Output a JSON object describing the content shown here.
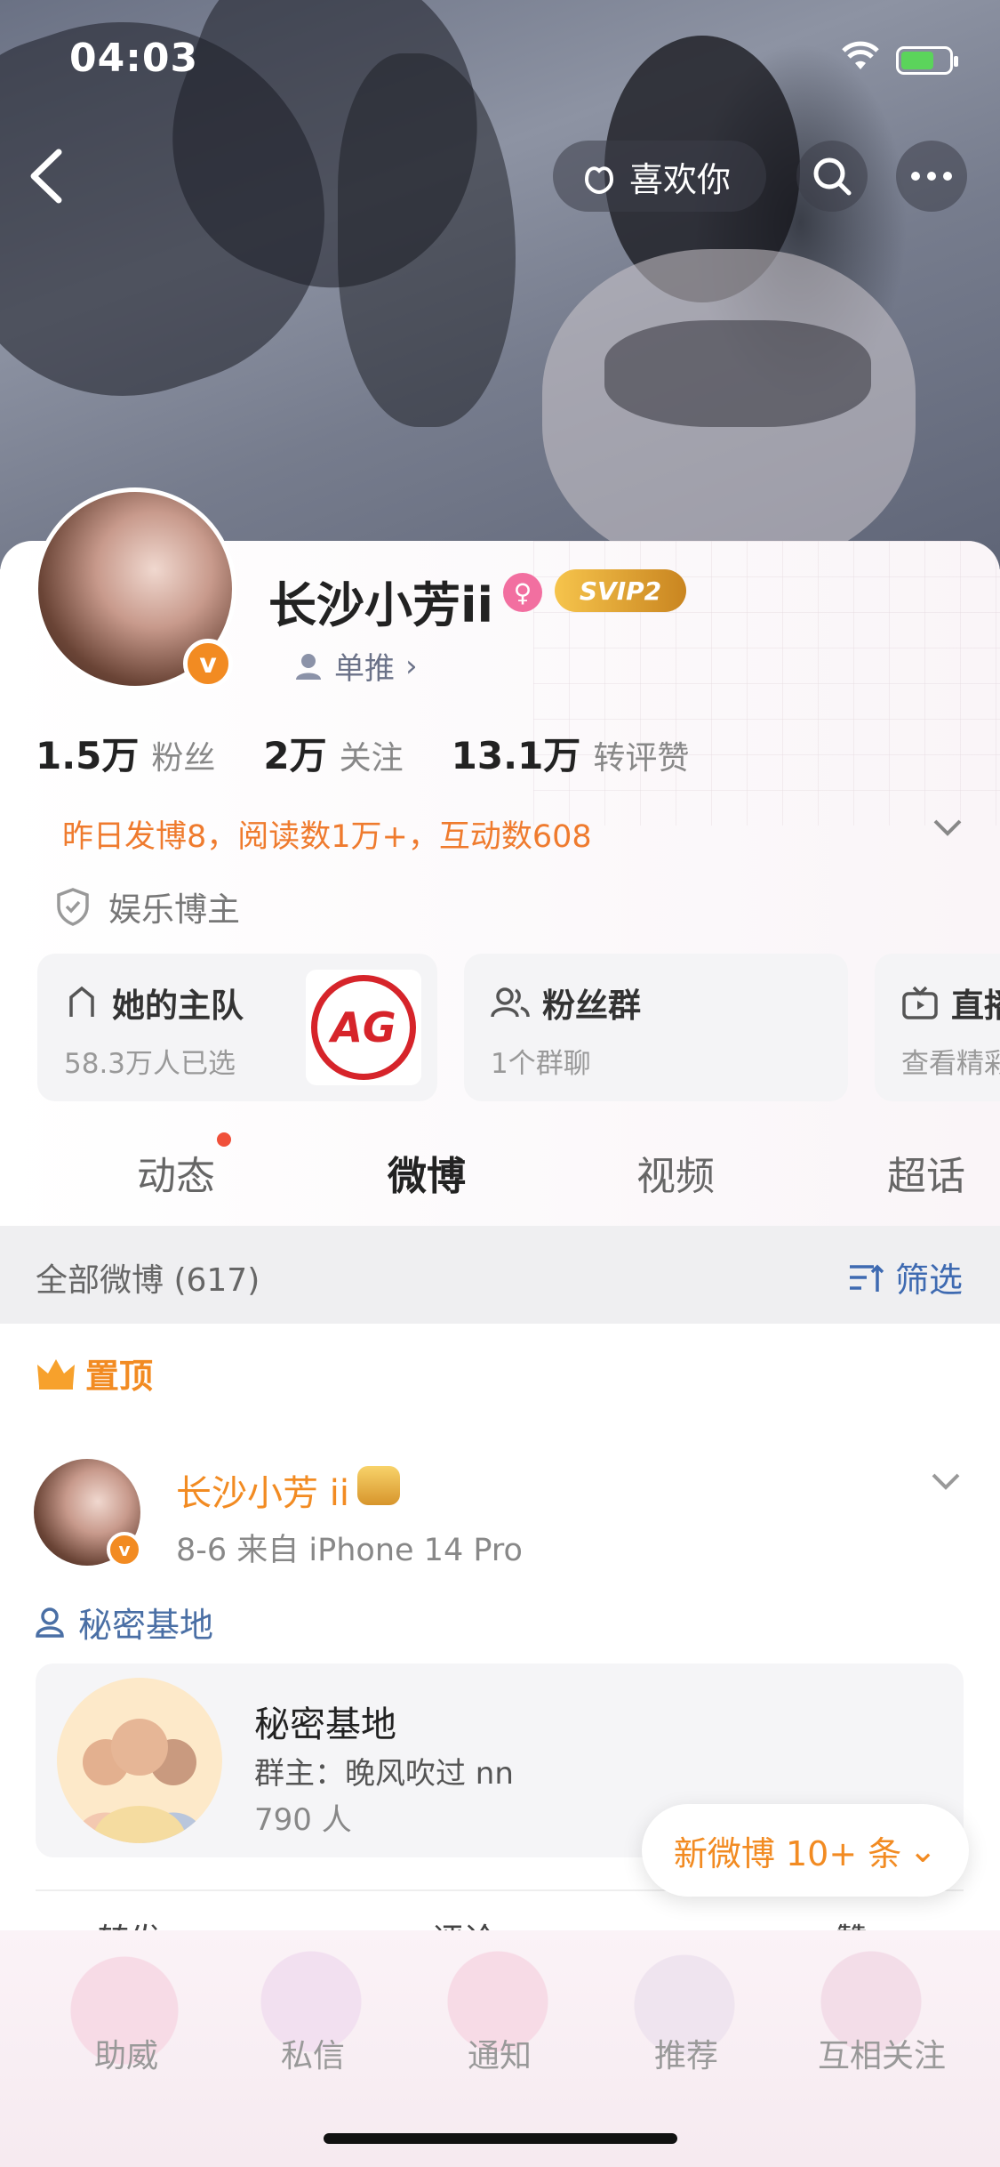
{
  "status_bar": {
    "time": "04:03"
  },
  "header": {
    "like_label": "喜欢你"
  },
  "profile": {
    "name": "长沙小芳ii",
    "vip": "SVIP2",
    "single_label": "单推",
    "stats": [
      {
        "num": "1.5万",
        "label": "粉丝"
      },
      {
        "num": "2万",
        "label": "关注"
      },
      {
        "num": "13.1万",
        "label": "转评赞"
      }
    ],
    "yesterday": "昨日发博8，阅读数1万+，互动数608",
    "category": "娱乐博主"
  },
  "boxes": [
    {
      "title": "她的主队",
      "sub": "58.3万人已选",
      "logo": "AG"
    },
    {
      "title": "粉丝群",
      "sub": "1个群聊"
    },
    {
      "title": "直播",
      "sub": "查看精彩回"
    }
  ],
  "tabs": [
    "动态",
    "微博",
    "视频",
    "超话"
  ],
  "filter": {
    "all": "全部微博 (617)",
    "filter_label": "筛选"
  },
  "pinned_label": "置顶",
  "post": {
    "author": "长沙小芳 ii",
    "meta": "8-6  来自 iPhone 14 Pro",
    "tag": "秘密基地",
    "group": {
      "title": "秘密基地",
      "owner": "群主：晚风吹过 nn",
      "count": "790 人"
    },
    "actions": [
      "转发",
      "评论",
      "赞"
    ]
  },
  "new_posts_pill": "新微博 10+ 条",
  "tabbar": [
    "助威",
    "私信",
    "通知",
    "推荐",
    "互相关注"
  ]
}
